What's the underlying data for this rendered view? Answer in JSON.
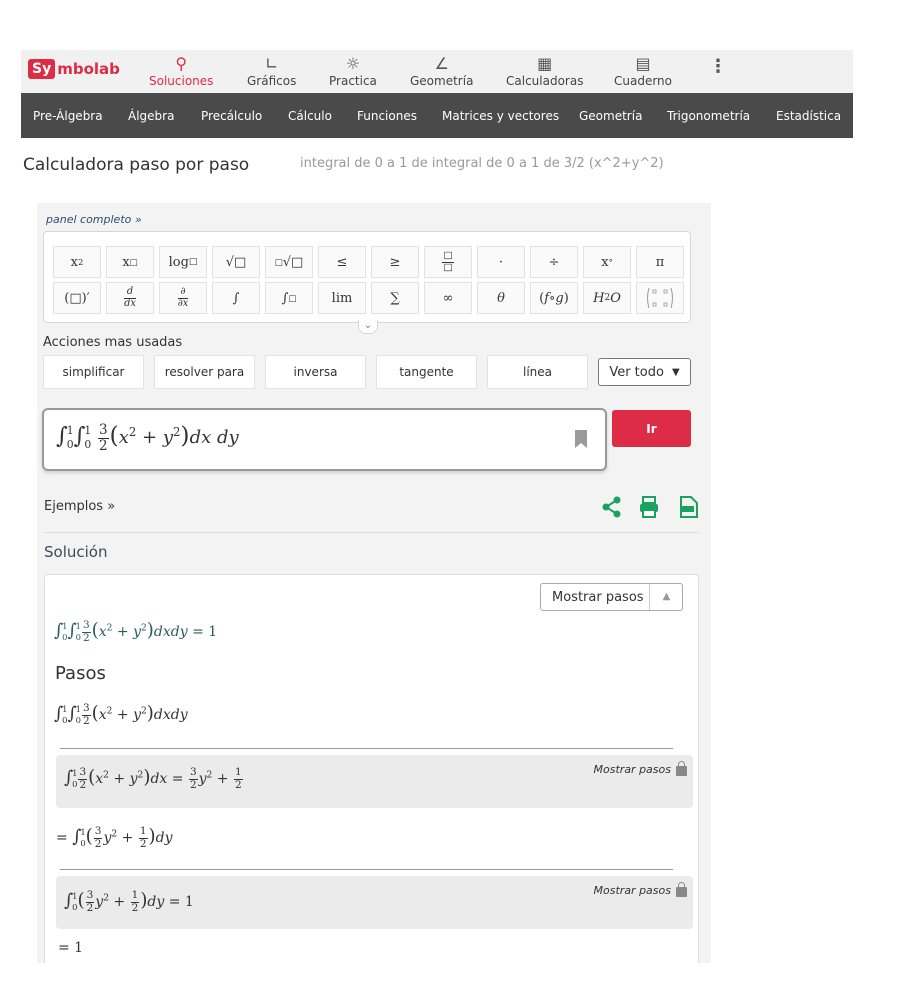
{
  "nav": {
    "logo_box": "Sy",
    "logo_rest": "mbolab",
    "items": [
      {
        "label": "Soluciones",
        "icon": "search-icon"
      },
      {
        "label": "Gráficos",
        "icon": "chart-icon"
      },
      {
        "label": "Practica",
        "icon": "lightbulb-icon"
      },
      {
        "label": "Geometría",
        "icon": "angle-icon"
      },
      {
        "label": "Calculadoras",
        "icon": "calculator-icon"
      },
      {
        "label": "Cuaderno",
        "icon": "notebook-icon"
      }
    ]
  },
  "subnav": [
    "Pre-Álgebra",
    "Álgebra",
    "Precálculo",
    "Cálculo",
    "Funciones",
    "Matrices y vectores",
    "Geometría",
    "Trigonometría",
    "Estadística"
  ],
  "page": {
    "title": "Calculadora paso por paso",
    "subtitle": "integral de 0 a 1 de integral de 0 a 1 de 3/2 (x^2+y^2)"
  },
  "panel": {
    "link": "panel completo »",
    "keys_row1": [
      "x²",
      "x□",
      "log□",
      "√□",
      "□√□",
      "≤",
      "≥",
      "□/□",
      "·",
      "÷",
      "x°",
      "π"
    ],
    "keys_row2": [
      "(□)′",
      "d/dx",
      "∂/∂x",
      "∫",
      "∫□□",
      "lim",
      "∑",
      "∞",
      "θ",
      "(f∘g)",
      "H₂O",
      "matrix"
    ]
  },
  "actions": {
    "title": "Acciones mas usadas",
    "buttons": [
      "simplificar",
      "resolver para",
      "inversa",
      "tangente",
      "línea"
    ],
    "ver_todo": "Ver todo"
  },
  "input": {
    "go": "Ir"
  },
  "examples": "Ejemplos »",
  "solution": {
    "heading": "Solución",
    "show_steps": "Mostrar pasos",
    "result": "1",
    "steps_heading": "Pasos",
    "step_link": "Mostrar pasos",
    "inner_result_coef": "3",
    "inner_result_den": "2",
    "final": "= 1"
  },
  "colors": {
    "brand": "#dd2c45",
    "subnav": "#4a4a4a",
    "share": "#1aa260"
  }
}
